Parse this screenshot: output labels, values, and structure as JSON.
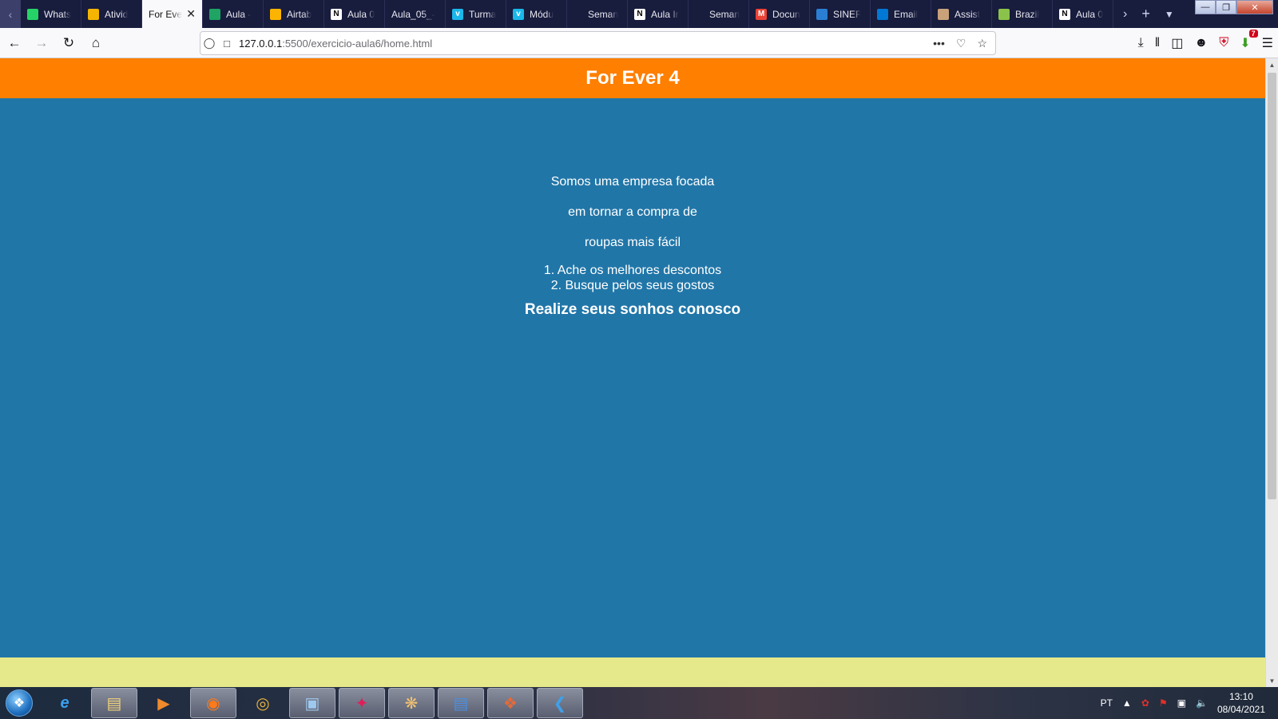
{
  "tabs": [
    {
      "label": "Whats",
      "icon": "whatsapp-icon",
      "color": "#25d366"
    },
    {
      "label": "Ativid",
      "icon": "classroom-icon",
      "color": "#f4b400"
    },
    {
      "label": "For Eve",
      "icon": "none",
      "active": true
    },
    {
      "label": "Aula -",
      "icon": "google-drive-icon",
      "color": "#1fa463"
    },
    {
      "label": "Airtab",
      "icon": "airtable-icon",
      "color": "#fcb400"
    },
    {
      "label": "Aula 0",
      "icon": "notion-icon",
      "color": "#ffffff"
    },
    {
      "label": "Aula_05_-",
      "icon": "none"
    },
    {
      "label": "Turma",
      "icon": "vimeo-icon",
      "color": "#1ab7ea"
    },
    {
      "label": "Módu",
      "icon": "vimeo-icon",
      "color": "#1ab7ea"
    },
    {
      "label": "Seman",
      "icon": "blank-icon"
    },
    {
      "label": "Aula Ir",
      "icon": "notion-icon",
      "color": "#ffffff"
    },
    {
      "label": "Seman",
      "icon": "blank-icon"
    },
    {
      "label": "Docun",
      "icon": "gmail-icon",
      "color": "#ea4335"
    },
    {
      "label": "SINEF",
      "icon": "sinef-icon",
      "color": "#2a7fd4"
    },
    {
      "label": "Email",
      "icon": "outlook-icon",
      "color": "#0078d4"
    },
    {
      "label": "Assist",
      "icon": "assist-icon",
      "color": "#c9a27a"
    },
    {
      "label": "Brazil",
      "icon": "brazil-icon",
      "color": "#8bc34a"
    },
    {
      "label": "Aula 0",
      "icon": "notion-icon",
      "color": "#ffffff"
    }
  ],
  "address": {
    "host": "127.0.0.1",
    "rest": ":5500/exercicio-aula6/home.html"
  },
  "page": {
    "title": "For Ever 4",
    "paragraphs": [
      "Somos uma empresa focada",
      "em tornar a compra de",
      "roupas mais fácil"
    ],
    "list": [
      "1. Ache os melhores descontos",
      "2. Busque pelos seus gostos"
    ],
    "tagline": "Realize seus sonhos conosco",
    "colors": {
      "header": "#ff7f00",
      "body": "#2176a8",
      "footer": "#e6e98b"
    }
  },
  "toolbar": {
    "extension_badge": "7"
  },
  "taskbar": {
    "language": "PT",
    "time": "13:10",
    "date": "08/04/2021"
  }
}
